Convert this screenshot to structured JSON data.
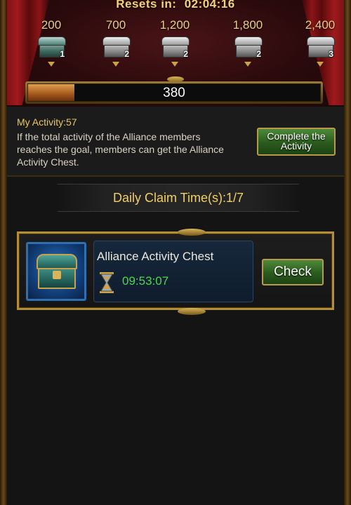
{
  "header": {
    "resets_label": "Resets in:",
    "resets_time": "02:04:16"
  },
  "milestones": [
    {
      "value": "200",
      "count": "1",
      "icon": "teal-chest-icon"
    },
    {
      "value": "700",
      "count": "2",
      "icon": "silver-chest-icon"
    },
    {
      "value": "1,200",
      "count": "2",
      "icon": "silver-chest-icon"
    },
    {
      "value": "1,800",
      "count": "2",
      "icon": "silver-chest-icon"
    },
    {
      "value": "2,400",
      "count": "3",
      "icon": "silver-chest-icon"
    }
  ],
  "progress": {
    "value_text": "380",
    "fill_fraction": 0.158
  },
  "activity": {
    "my_activity": "My Activity:57",
    "description": "If the total activity of the Alliance members reaches the goal, members can get the Alliance Activity Chest.",
    "complete_button": "Complete the Activity"
  },
  "daily_claim": {
    "text": "Daily Claim Time(s):1/7"
  },
  "chest_card": {
    "title": "Alliance Activity Chest",
    "timer": "09:53:07",
    "check_button": "Check",
    "icon": "alliance-chest-icon"
  },
  "colors": {
    "gold": "#f1cf64",
    "timer_green": "#4fd64f",
    "button_green": "#2a5a1e",
    "curtain_red": "#9e1a1d"
  }
}
